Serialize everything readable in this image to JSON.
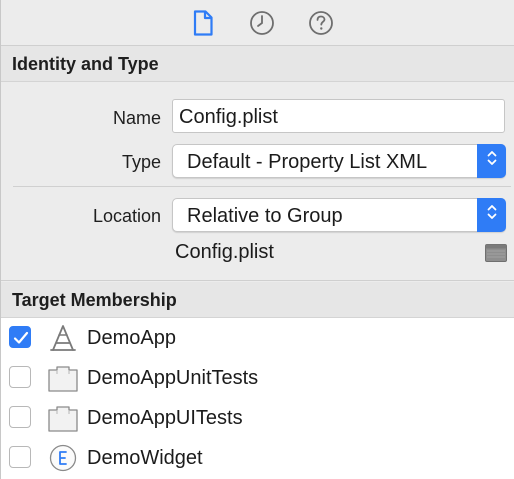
{
  "tabs": [
    {
      "name": "file-inspector",
      "icon": "document-icon",
      "active": true
    },
    {
      "name": "history-inspector",
      "icon": "clock-icon",
      "active": false
    },
    {
      "name": "quick-help-inspector",
      "icon": "help-icon",
      "active": false
    }
  ],
  "identity": {
    "header": "Identity and Type",
    "name_label": "Name",
    "name_value": "Config.plist",
    "type_label": "Type",
    "type_value": "Default - Property List XML",
    "location_label": "Location",
    "location_value": "Relative to Group",
    "full_path": "Config.plist"
  },
  "membership": {
    "header": "Target Membership",
    "targets": [
      {
        "label": "DemoApp",
        "checked": true,
        "icon": "app-target-icon"
      },
      {
        "label": "DemoAppUnitTests",
        "checked": false,
        "icon": "test-bundle-icon"
      },
      {
        "label": "DemoAppUITests",
        "checked": false,
        "icon": "test-bundle-icon"
      },
      {
        "label": "DemoWidget",
        "checked": false,
        "icon": "extension-icon"
      }
    ]
  },
  "colors": {
    "accent": "#2f7cf6",
    "panel": "#ececec",
    "header": "#e6e6e6"
  }
}
